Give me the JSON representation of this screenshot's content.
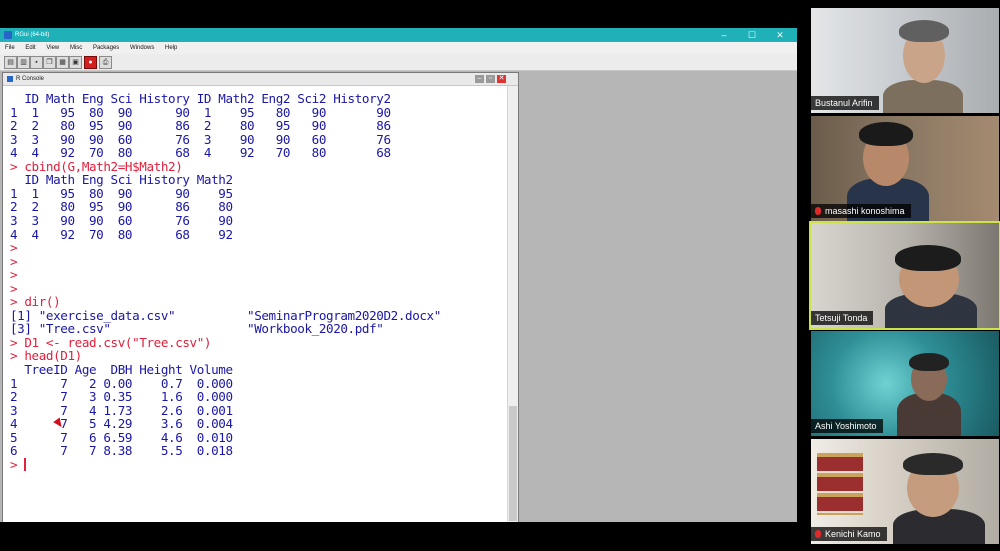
{
  "app": {
    "title": "RGui (64-bit)",
    "menu": [
      "File",
      "Edit",
      "View",
      "Misc",
      "Packages",
      "Windows",
      "Help"
    ],
    "window_controls": [
      "–",
      "☐",
      "✕"
    ],
    "toolbar_icons": [
      "open-script-icon",
      "load-workspace-icon",
      "save-workspace-icon",
      "copy-icon",
      "paste-icon",
      "copy-paste-icon",
      "stop-icon",
      "print-icon"
    ]
  },
  "console": {
    "title": "R Console",
    "lines": [
      {
        "kind": "out",
        "text": "  ID Math Eng Sci History ID Math2 Eng2 Sci2 History2"
      },
      {
        "kind": "out",
        "text": "1  1   95  80  90      90  1    95   80   90       90"
      },
      {
        "kind": "out",
        "text": "2  2   80  95  90      86  2    80   95   90       86"
      },
      {
        "kind": "out",
        "text": "3  3   90  90  60      76  3    90   90   60       76"
      },
      {
        "kind": "out",
        "text": "4  4   92  70  80      68  4    92   70   80       68"
      },
      {
        "kind": "cmd",
        "text": "> cbind(G,Math2=H$Math2)"
      },
      {
        "kind": "out",
        "text": "  ID Math Eng Sci History Math2"
      },
      {
        "kind": "out",
        "text": "1  1   95  80  90      90    95"
      },
      {
        "kind": "out",
        "text": "2  2   80  95  90      86    80"
      },
      {
        "kind": "out",
        "text": "3  3   90  90  60      76    90"
      },
      {
        "kind": "out",
        "text": "4  4   92  70  80      68    92"
      },
      {
        "kind": "cmd",
        "text": ">"
      },
      {
        "kind": "cmd",
        "text": ">"
      },
      {
        "kind": "cmd",
        "text": ">"
      },
      {
        "kind": "cmd",
        "text": ">"
      },
      {
        "kind": "cmd",
        "text": "> dir()"
      },
      {
        "kind": "out",
        "text": "[1] \"exercise_data.csv\"          \"SeminarProgram2020D2.docx\""
      },
      {
        "kind": "out",
        "text": "[3] \"Tree.csv\"                   \"Workbook_2020.pdf\""
      },
      {
        "kind": "cmd",
        "text": "> D1 <- read.csv(\"Tree.csv\")"
      },
      {
        "kind": "cmd",
        "text": "> head(D1)"
      },
      {
        "kind": "out",
        "text": "  TreeID Age  DBH Height Volume"
      },
      {
        "kind": "out",
        "text": "1      7   2 0.00    0.7  0.000"
      },
      {
        "kind": "out",
        "text": "2      7   3 0.35    1.6  0.000"
      },
      {
        "kind": "out",
        "text": "3      7   4 1.73    2.6  0.001"
      },
      {
        "kind": "out",
        "text": "4      7   5 4.29    3.6  0.004"
      },
      {
        "kind": "out",
        "text": "5      7   6 6.59    4.6  0.010"
      },
      {
        "kind": "out",
        "text": "6      7   7 8.38    5.5  0.018"
      },
      {
        "kind": "cmd",
        "text": ">"
      }
    ]
  },
  "participants": [
    {
      "name": "Bustanul Arifin",
      "muted": false,
      "active": false
    },
    {
      "name": "masashi konoshima",
      "muted": true,
      "active": false
    },
    {
      "name": "Tetsuji Tonda",
      "muted": false,
      "active": true
    },
    {
      "name": "Ashi Yoshimoto",
      "muted": false,
      "active": false
    },
    {
      "name": "Kenichi Kamo",
      "muted": true,
      "active": false
    }
  ],
  "colors": {
    "titlebar": "#1fb0b8",
    "output_text": "#1a17a6",
    "command_text": "#e0203c",
    "active_speaker": "#cde34a"
  }
}
